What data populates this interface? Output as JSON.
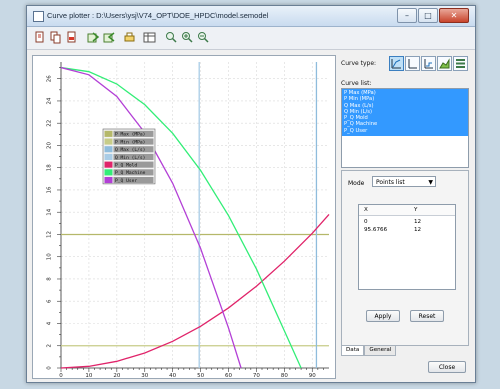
{
  "window": {
    "title": "Curve plotter : D:\\Users\\ysj\\V74_OPT\\DOE_HPDC\\model.semodel",
    "minimize": "–",
    "maximize": "□",
    "close": "✕"
  },
  "toolbar": {
    "icons": [
      "new-icon",
      "copy-icon",
      "pdf-icon",
      "import-icon",
      "export-icon",
      "print-icon",
      "table-icon",
      "zoom-icon",
      "zoom-in-icon",
      "zoom-out-icon"
    ]
  },
  "right_panel": {
    "curve_type_label": "Curve type:",
    "curve_list_label": "Curve list:",
    "curve_list": [
      "P Max (MPa)",
      "P Min (MPa)",
      "Q Max (L/s)",
      "Q Min (L/s)",
      "P_Q Mold",
      "P_Q Machine",
      "P_Q User"
    ],
    "mode_label": "Mode",
    "mode_value": "Points list",
    "table_headers": [
      "X",
      "Y"
    ],
    "table_rows": [
      [
        "0",
        "12"
      ],
      [
        "95.6766",
        "12"
      ]
    ],
    "apply_button": "Apply",
    "reset_button": "Reset",
    "tabs": [
      "Data",
      "General"
    ],
    "close_button": "Close"
  },
  "chart_data": {
    "type": "line",
    "x_ticks": [
      "0",
      "10",
      "20",
      "30",
      "40",
      "50",
      "60",
      "70",
      "80",
      "90"
    ],
    "y_ticks": [
      "0",
      "2",
      "4",
      "6",
      "8",
      "10",
      "12",
      "14",
      "16",
      "18",
      "20",
      "22",
      "24",
      "26"
    ],
    "xlim": [
      0,
      96
    ],
    "ylim": [
      0,
      27.5
    ],
    "legend": {
      "placement": "center-left",
      "entries": [
        {
          "label": "P Max (MPa)",
          "color": "#b5b86a"
        },
        {
          "label": "P Min (MPa)",
          "color": "#c7cc88"
        },
        {
          "label": "Q Max (L/s)",
          "color": "#8fbcdc"
        },
        {
          "label": "Q Min (L/s)",
          "color": "#a9cce6"
        },
        {
          "label": "P_Q Mold",
          "color": "#e0246a"
        },
        {
          "label": "P_Q Machine",
          "color": "#33ee77"
        },
        {
          "label": "P_Q User",
          "color": "#b340d6"
        }
      ]
    },
    "series": [
      {
        "name": "P Max (MPa)",
        "color": "#b5b86a",
        "points": [
          [
            0,
            12
          ],
          [
            96,
            12
          ]
        ]
      },
      {
        "name": "P Min (MPa)",
        "color": "#c7cc88",
        "points": [
          [
            0,
            2
          ],
          [
            96,
            2
          ]
        ]
      },
      {
        "name": "Q Max (L/s)",
        "color": "#8fbcdc",
        "points": [
          [
            91.5,
            0
          ],
          [
            91.5,
            27.5
          ]
        ]
      },
      {
        "name": "Q Min (L/s)",
        "color": "#a9cce6",
        "points": [
          [
            49.5,
            0
          ],
          [
            49.5,
            27.5
          ]
        ]
      },
      {
        "name": "P_Q Mold",
        "color": "#e0246a",
        "points": [
          [
            0,
            0
          ],
          [
            10,
            0.15
          ],
          [
            20,
            0.6
          ],
          [
            30,
            1.35
          ],
          [
            40,
            2.4
          ],
          [
            50,
            3.75
          ],
          [
            60,
            5.4
          ],
          [
            70,
            7.35
          ],
          [
            80,
            9.6
          ],
          [
            90,
            12.1
          ],
          [
            96,
            13.8
          ]
        ]
      },
      {
        "name": "P_Q Machine",
        "color": "#33ee77",
        "points": [
          [
            0,
            27
          ],
          [
            10,
            26.63
          ],
          [
            20,
            25.52
          ],
          [
            30,
            23.67
          ],
          [
            40,
            21.09
          ],
          [
            50,
            17.76
          ],
          [
            60,
            13.7
          ],
          [
            70,
            8.9
          ],
          [
            80,
            3.35
          ],
          [
            86,
            0
          ]
        ]
      },
      {
        "name": "P_Q User",
        "color": "#b340d6",
        "points": [
          [
            0,
            27
          ],
          [
            10,
            26.35
          ],
          [
            20,
            24.4
          ],
          [
            30,
            21.15
          ],
          [
            40,
            16.6
          ],
          [
            50,
            10.75
          ],
          [
            60,
            3.6
          ],
          [
            64.5,
            0
          ]
        ]
      }
    ]
  }
}
